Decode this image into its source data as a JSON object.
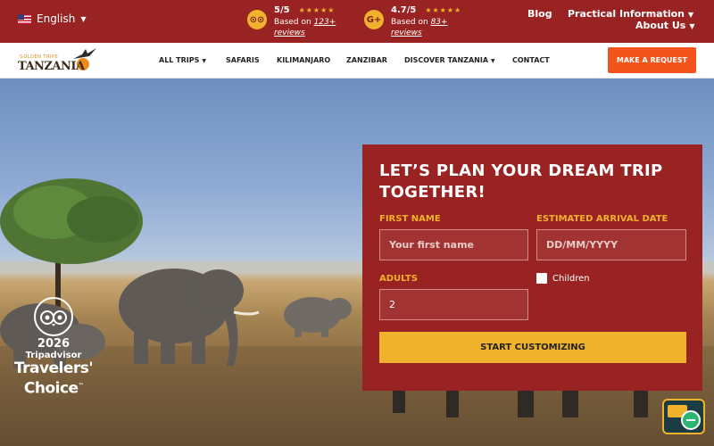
{
  "topbar": {
    "language": "English",
    "tripadvisor": {
      "badge": "⊙⊙",
      "score": "5/5",
      "stars": "★★★★★",
      "based_on": "Based on",
      "count": "123+",
      "reviews": "reviews"
    },
    "google": {
      "badge": "G+",
      "score": "4.7/5",
      "stars": "★★★★★",
      "based_on": "Based on",
      "count": "83+",
      "reviews": "reviews"
    },
    "links": {
      "blog": "Blog",
      "practical": "Practical Information",
      "about": "About Us"
    }
  },
  "nav": {
    "logo_small": "GOLDEN TRIPS",
    "logo_big": "TANZANIA",
    "items": [
      "ALL TRIPS",
      "SAFARIS",
      "KILIMANJARO",
      "ZANZIBAR",
      "DISCOVER TANZANIA",
      "CONTACT"
    ],
    "cta": "MAKE A REQUEST"
  },
  "badge": {
    "year": "2026",
    "brand": "Tripadvisor",
    "line1": "Travelers'",
    "line2": "Choice",
    "tm": "™"
  },
  "form": {
    "title_line1": "LET’S PLAN YOUR DREAM TRIP",
    "title_line2": "TOGETHER!",
    "first_name_label": "FIRST NAME",
    "first_name_placeholder": "Your first name",
    "arrival_label": "ESTIMATED ARRIVAL DATE",
    "arrival_placeholder": "DD/MM/YYYY",
    "adults_label": "ADULTS",
    "adults_value": "2",
    "children_label": "Children",
    "submit": "START CUSTOMIZING"
  },
  "colors": {
    "brand_red": "#992322",
    "accent_gold": "#f0b12c",
    "cta_orange": "#f2541b"
  }
}
